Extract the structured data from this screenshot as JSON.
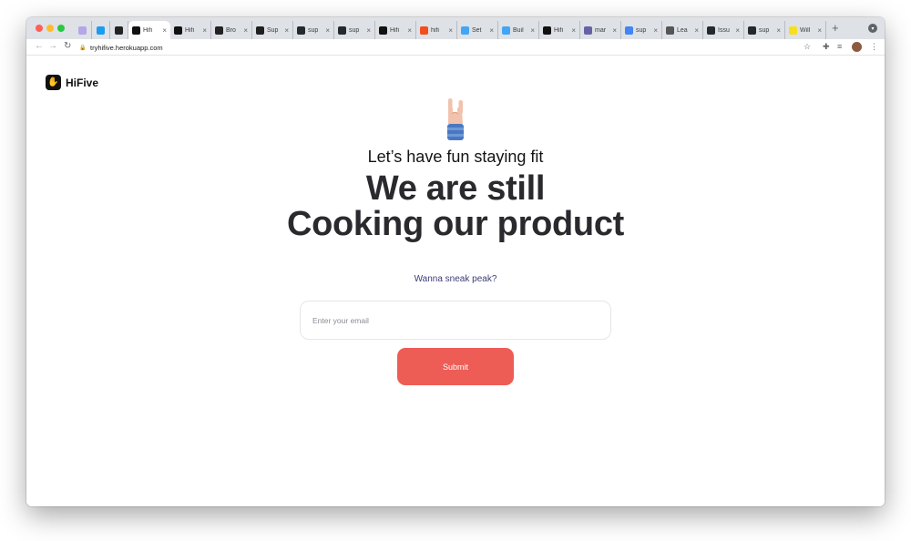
{
  "browser": {
    "tabs": [
      {
        "label": "",
        "icon": "kite-icon",
        "color": "#b4a7e8",
        "pinned": true
      },
      {
        "label": "",
        "icon": "twitter-icon",
        "color": "#1d9bf0",
        "pinned": true
      },
      {
        "label": "",
        "icon": "app-icon",
        "color": "#222222",
        "pinned": true
      },
      {
        "label": "Hifi",
        "icon": "hifive-icon",
        "color": "#111111",
        "active": true
      },
      {
        "label": "Hifi",
        "icon": "hifive-icon",
        "color": "#111111"
      },
      {
        "label": "Bro",
        "icon": "app-icon",
        "color": "#222222"
      },
      {
        "label": "Sup",
        "icon": "supabase-icon",
        "color": "#1f1f1f"
      },
      {
        "label": "sup",
        "icon": "github-icon",
        "color": "#24292f"
      },
      {
        "label": "sup",
        "icon": "github-icon",
        "color": "#24292f"
      },
      {
        "label": "Hifi",
        "icon": "hifive-icon",
        "color": "#111111"
      },
      {
        "label": "hifi",
        "icon": "figma-icon",
        "color": "#f24e1e"
      },
      {
        "label": "Set",
        "icon": "flutter-icon",
        "color": "#42a5f5"
      },
      {
        "label": "Buil",
        "icon": "flutter-icon",
        "color": "#42a5f5"
      },
      {
        "label": "Hifi",
        "icon": "hifive-icon",
        "color": "#111111"
      },
      {
        "label": "mar",
        "icon": "heroku-icon",
        "color": "#6762a6"
      },
      {
        "label": "sup",
        "icon": "google-icon",
        "color": "#4285f4"
      },
      {
        "label": "Lea",
        "icon": "glasses-icon",
        "color": "#555555"
      },
      {
        "label": "Issu",
        "icon": "github-icon",
        "color": "#24292f"
      },
      {
        "label": "sup",
        "icon": "github-icon",
        "color": "#24292f"
      },
      {
        "label": "Will",
        "icon": "bolt-icon",
        "color": "#f7df1e"
      }
    ],
    "url": "tryhifive.herokuapp.com"
  },
  "page": {
    "brand": "HiFive",
    "tagline": "Let’s have fun staying fit",
    "headline_line1": "We are still",
    "headline_line2": "Cooking our product",
    "sneak_peek": "Wanna sneak peak?",
    "email_placeholder": "Enter your email",
    "submit_label": "Submit",
    "accent_color": "#ee5c56"
  }
}
